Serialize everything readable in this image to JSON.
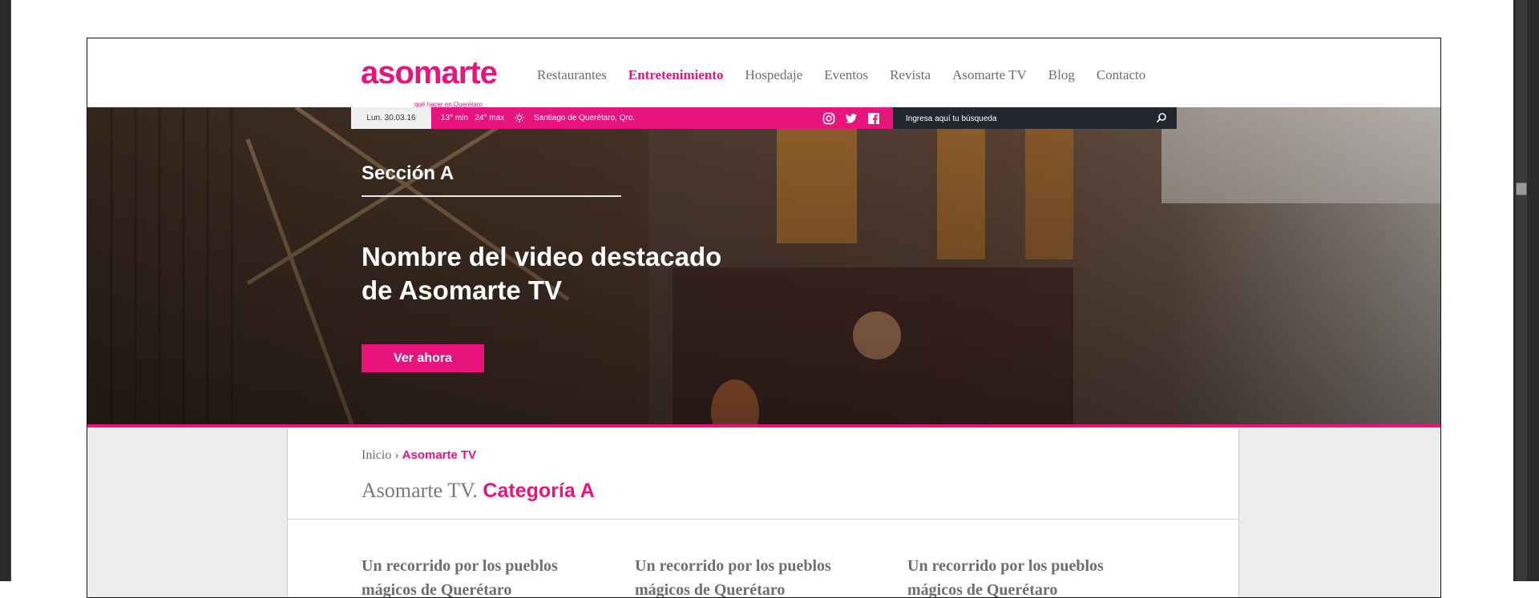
{
  "header": {
    "logo_text": "asomarte",
    "logo_tagline": "qué hacer en Querétaro",
    "brand_color": "#e8137d",
    "nav": [
      {
        "label": "Restaurantes",
        "active": false
      },
      {
        "label": "Entretenimiento",
        "active": true
      },
      {
        "label": "Hospedaje",
        "active": false
      },
      {
        "label": "Eventos",
        "active": false
      },
      {
        "label": "Revista",
        "active": false
      },
      {
        "label": "Asomarte TV",
        "active": false
      },
      {
        "label": "Blog",
        "active": false
      },
      {
        "label": "Contacto",
        "active": false
      }
    ]
  },
  "topbar": {
    "date": "Lun. 30.03.16",
    "temperature": "13° min   24° max",
    "weather_icon": "sun-icon",
    "city": "Santiago de Querétaro, Qro.",
    "social": [
      "instagram-icon",
      "twitter-icon",
      "facebook-icon"
    ],
    "search_placeholder": "Ingresa aquí tu búsqueda",
    "search_icon": "search-icon"
  },
  "hero": {
    "section": "Sección A",
    "title": "Nombre del video destacado de Asomarte TV",
    "button": "Ver ahora"
  },
  "breadcrumb": {
    "home": "Inicio",
    "separator": "›",
    "current": "Asomarte TV"
  },
  "page_title": {
    "prefix": "Asomarte TV.",
    "category": "Categoría A"
  },
  "cards": [
    {
      "title": "Un recorrido por los pueblos mágicos de Querétaro"
    },
    {
      "title": "Un recorrido por los pueblos mágicos de Querétaro"
    },
    {
      "title": "Un recorrido por los pueblos mágicos de Querétaro"
    }
  ]
}
